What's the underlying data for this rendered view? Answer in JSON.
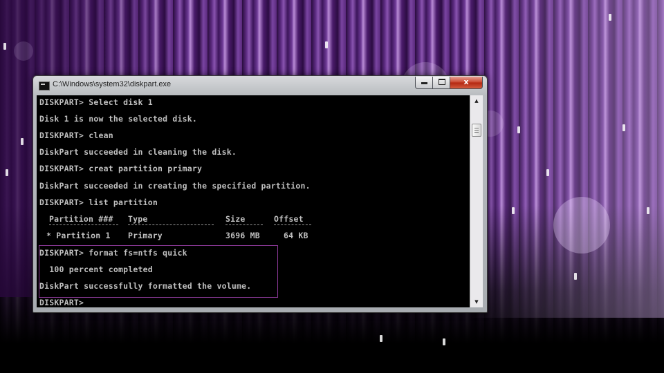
{
  "window": {
    "title": "C:\\Windows\\system32\\diskpart.exe",
    "close_glyph": "x",
    "icon": "console-app-icon"
  },
  "console": {
    "lines": [
      "DISKPART> Select disk 1",
      "Disk 1 is now the selected disk.",
      "DISKPART> clean",
      "DiskPart succeeded in cleaning the disk.",
      "DISKPART> creat partition primary",
      "DiskPart succeeded in creating the specified partition.",
      "DISKPART> list partition",
      "DISKPART> format fs=ntfs quick",
      "  100 percent completed",
      "DiskPart successfully formatted the volume.",
      "DISKPART>"
    ],
    "partition_table": {
      "headers": [
        "Partition ###",
        "Type",
        "Size",
        "Offset"
      ],
      "rows": [
        [
          "* Partition 1",
          "Primary",
          "3696 MB",
          "64 KB"
        ]
      ]
    }
  },
  "colors": {
    "console_text": "#c0c0c0",
    "console_bg": "#000000",
    "highlight_border": "#8e3a9a",
    "close_button": "#c9462f",
    "wallpaper_accent": "#6e3a96"
  }
}
